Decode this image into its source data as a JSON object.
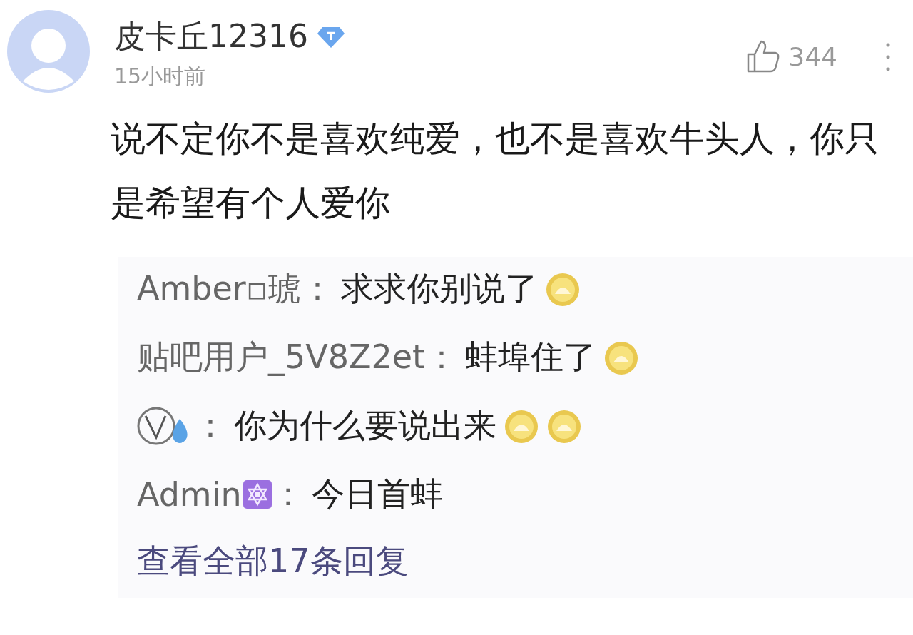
{
  "comment": {
    "username": "皮卡丘12316",
    "verified": true,
    "time": "15小时前",
    "likes": "344",
    "text": "说不定你不是喜欢纯爱，也不是喜欢牛头人，你只是希望有个人爱你"
  },
  "replies": [
    {
      "author": {
        "kind": "text",
        "name": "Amber▫琥",
        "badge": false
      },
      "separator": "：",
      "text": "求求你别说了",
      "emojis": [
        {
          "kind": "face"
        }
      ]
    },
    {
      "author": {
        "kind": "text",
        "name": "贴吧用户_5V8Z2et",
        "badge": false
      },
      "separator": "：",
      "text": "蚌埠住了",
      "emojis": [
        {
          "kind": "face"
        }
      ]
    },
    {
      "author": {
        "kind": "icon"
      },
      "separator": "：",
      "text": "你为什么要说出来",
      "emojis": [
        {
          "kind": "face"
        },
        {
          "kind": "face"
        }
      ]
    },
    {
      "author": {
        "kind": "text",
        "name": "Admin",
        "badge": true
      },
      "separator": "：",
      "text": "今日首蚌"
    }
  ],
  "view_all": "查看全部17条回复"
}
